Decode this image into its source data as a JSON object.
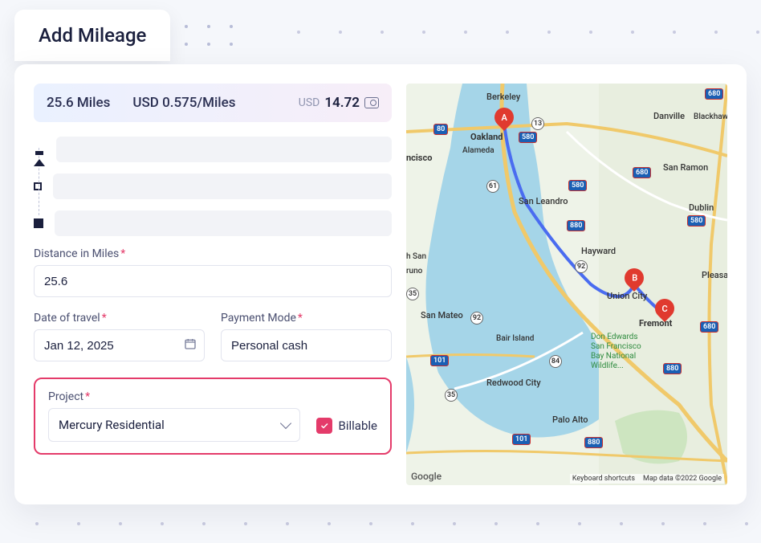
{
  "tab": {
    "title": "Add Mileage"
  },
  "summary": {
    "miles": "25.6 Miles",
    "rate": "USD 0.575/Miles",
    "currency": "USD",
    "total": "14.72"
  },
  "form": {
    "distance_label": "Distance in Miles",
    "distance_value": "25.6",
    "date_label": "Date of travel",
    "date_value": "Jan 12, 2025",
    "payment_label": "Payment Mode",
    "payment_value": "Personal cash",
    "project_label": "Project",
    "project_value": "Mercury Residential",
    "billable_label": "Billable"
  },
  "map": {
    "pins": {
      "a": "A",
      "b": "B",
      "c": "C"
    },
    "cities": {
      "oakland": "Oakland",
      "berkeley": "Berkeley",
      "alameda": "Alameda",
      "ncisco": "ncisco",
      "san_leandro": "San Leandro",
      "hayward": "Hayward",
      "union_city": "Union City",
      "fremont": "Fremont",
      "san_mateo": "San Mateo",
      "redwood": "Redwood City",
      "palo_alto": "Palo Alto",
      "danville": "Danville",
      "san_ramon": "San Ramon",
      "dublin": "Dublin",
      "pleasa": "Pleasa",
      "blackhawk": "Blackhawk",
      "bair": "Bair Island",
      "n_san": "h San",
      "runo": "runo"
    },
    "park": "Don Edwards\nSan Francisco\nBay National\nWildlife...",
    "legal": {
      "kbd": "Keyboard shortcuts",
      "data": "Map data ©2022 Google"
    },
    "brand": "Google",
    "hwy": {
      "i80a": "80",
      "i580a": "580",
      "i580b": "580",
      "i580c": "580",
      "i680a": "680",
      "i680b": "680",
      "i680c": "680",
      "i880a": "880",
      "i880b": "880",
      "i880c": "880",
      "r13": "13",
      "r61": "61",
      "r35": "35",
      "r84": "84",
      "r92a": "92",
      "r92b": "92",
      "r101a": "101",
      "r101b": "101"
    }
  }
}
